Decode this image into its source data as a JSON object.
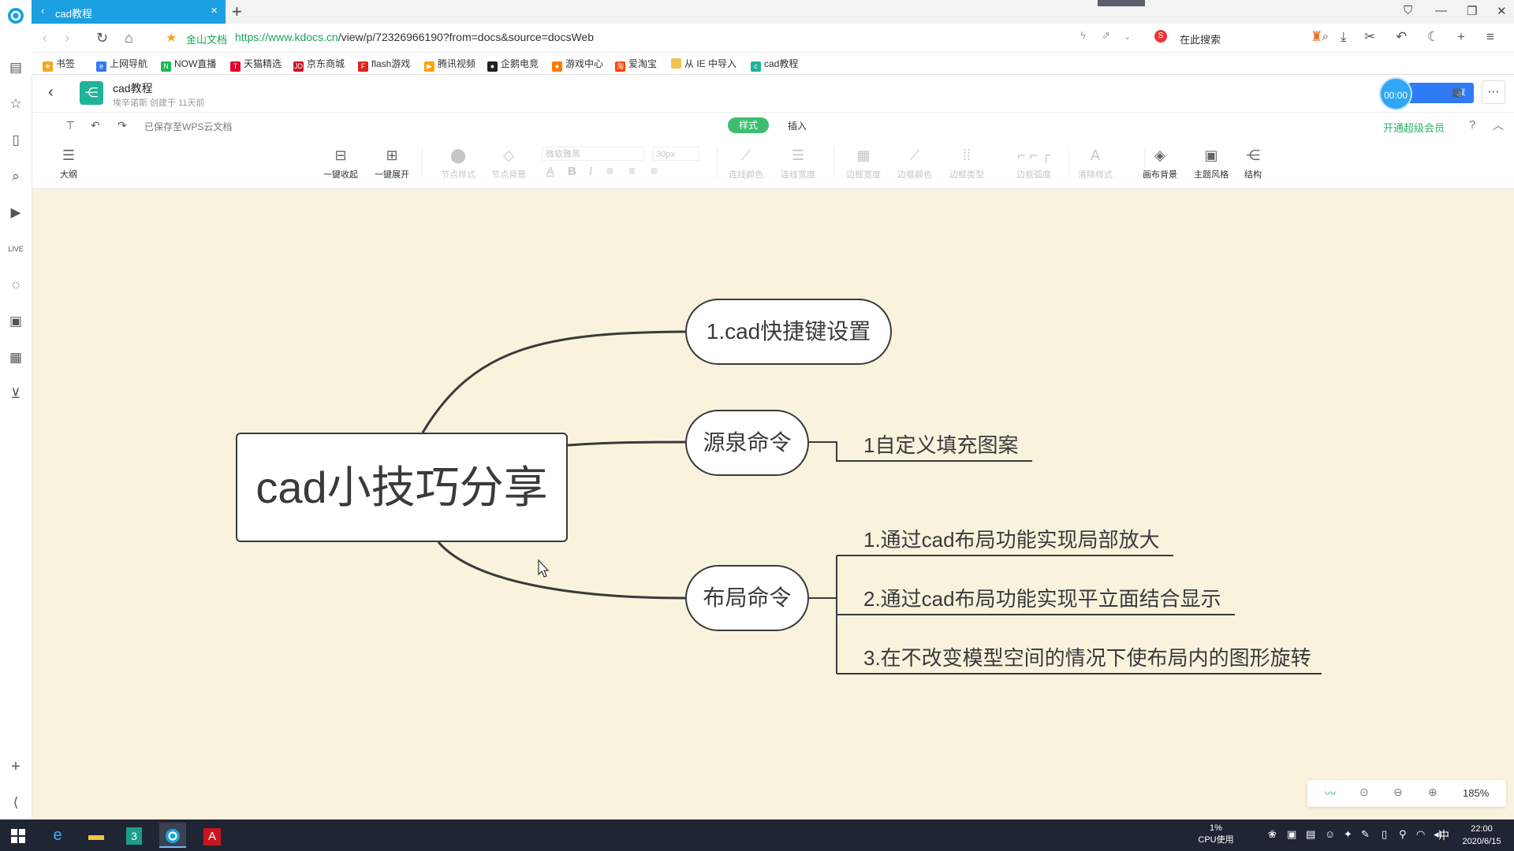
{
  "browser": {
    "tab_title": "cad教程",
    "new_tab": "+",
    "url_site": "金山文档",
    "url_domain": "https://www.kdocs.cn",
    "url_path": "/view/p/72326966190?from=docs&source=docsWeb",
    "search_text": "在此搜索"
  },
  "bookmarks": [
    {
      "label": "书签",
      "color": "#f5a623"
    },
    {
      "label": "上网导航",
      "color": "#2f7bf5"
    },
    {
      "label": "NOW直播",
      "color": "#1db954"
    },
    {
      "label": "天猫精选",
      "color": "#e4002b"
    },
    {
      "label": "京东商城",
      "color": "#c91623"
    },
    {
      "label": "flash游戏",
      "color": "#e2231a"
    },
    {
      "label": "腾讯视频",
      "color": "#ff9f00"
    },
    {
      "label": "企鹅电竞",
      "color": "#222222"
    },
    {
      "label": "游戏中心",
      "color": "#ff7a00"
    },
    {
      "label": "爱淘宝",
      "color": "#ff4400"
    },
    {
      "label": "从 IE 中导入",
      "color": "#f2c14e"
    },
    {
      "label": "cad教程",
      "color": "#1fb39a"
    }
  ],
  "doc": {
    "title": "cad教程",
    "meta": "埃辛诺斯  创建于 11天前",
    "share_label": "享",
    "timer": "00:00"
  },
  "toolbar": {
    "saved_text": "已保存至WPS云文档",
    "tab_style": "样式",
    "tab_insert": "插入",
    "vip": "开通超级会员",
    "outline": "大纲",
    "collapse_all": "一键收起",
    "expand_all": "一键展开",
    "node_style": "节点样式",
    "node_bg": "节点背景",
    "font_name": "微软雅黑",
    "font_size": "30px",
    "line_color": "连线颜色",
    "line_width": "连线宽度",
    "border_width": "边框宽度",
    "border_color": "边框颜色",
    "border_type": "边框类型",
    "border_radius": "边框弧度",
    "clear_style": "清除样式",
    "canvas_bg": "画布背景",
    "theme": "主题风格",
    "structure": "结构"
  },
  "mindmap": {
    "root": "cad小技巧分享",
    "branches": [
      {
        "label": "1.cad快捷键设置",
        "children": []
      },
      {
        "label": "源泉命令",
        "children": [
          "1自定义填充图案"
        ]
      },
      {
        "label": "布局命令",
        "children": [
          "1.通过cad布局功能实现局部放大",
          "2.通过cad布局功能实现平立面结合显示",
          "3.在不改变模型空间的情况下使布局内的图形旋转"
        ]
      }
    ]
  },
  "zoom": {
    "level": "185%"
  },
  "taskbar": {
    "cpu_value": "1%",
    "cpu_label": "CPU使用",
    "ime": "中",
    "time": "22:00",
    "date": "2020/6/15"
  },
  "colors": {
    "accent": "#1a9fe0",
    "canvas": "#f9f2dd",
    "node_border": "#3a3a3a",
    "green": "#3bbf6f"
  }
}
